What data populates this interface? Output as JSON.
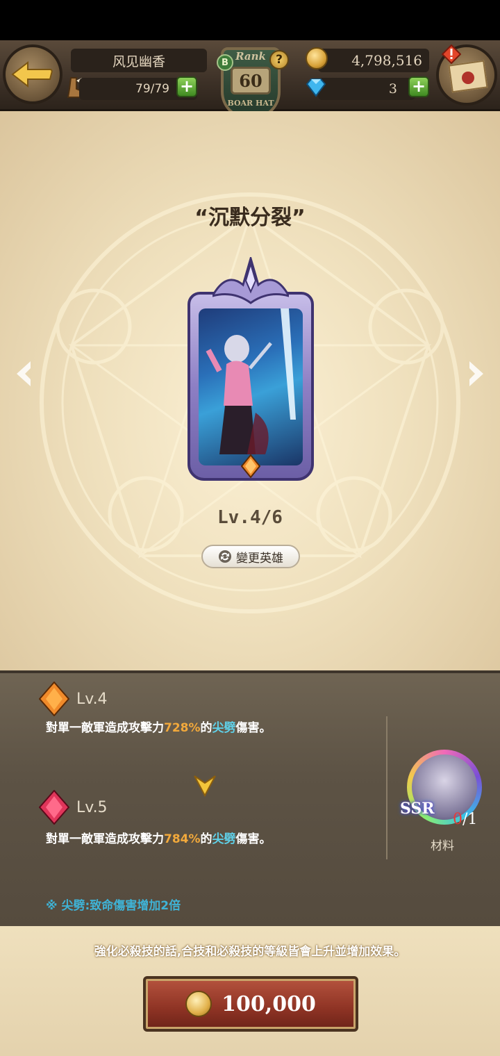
{
  "header": {
    "player_name": "风见幽香",
    "stamina": "79/79",
    "rank_label": "Rank",
    "rank_value": "60",
    "rank_tag": "B",
    "rank_title": "BOAR HAT",
    "gold": "4,798,516",
    "gems": "3",
    "icons": [
      "back-arrow-icon",
      "boot-icon",
      "plus-icon",
      "help-icon",
      "coin-icon",
      "gem-icon",
      "mail-icon",
      "alert-icon"
    ]
  },
  "skill": {
    "title": "“沉默分裂”",
    "level": "Lv.4/6",
    "change_hero_label": "變更英雄"
  },
  "levels": [
    {
      "label": "Lv.4",
      "desc_prefix": "對單一敵軍造成攻擊力",
      "percent": "728%",
      "desc_mid": "的",
      "damage_type": "尖劈",
      "desc_suffix": "傷害。",
      "gem_color": "#f08a2a"
    },
    {
      "label": "Lv.5",
      "desc_prefix": "對單一敵軍造成攻擊力",
      "percent": "784%",
      "desc_mid": "的",
      "damage_type": "尖劈",
      "desc_suffix": "傷害。",
      "gem_color": "#e0355a"
    }
  ],
  "note": "※ 尖劈:致命傷害增加2倍",
  "material": {
    "rarity": "SSR",
    "owned": "0",
    "required": "/1",
    "label": "材料"
  },
  "bottom": {
    "hint": "強化必殺技的話,合技和必殺技的等級皆會上升並增加效果。",
    "cost": "100,000"
  },
  "colors": {
    "accent_orange": "#f2a93b",
    "accent_cyan": "#5fd0e8",
    "button_red": "#8e3324"
  }
}
